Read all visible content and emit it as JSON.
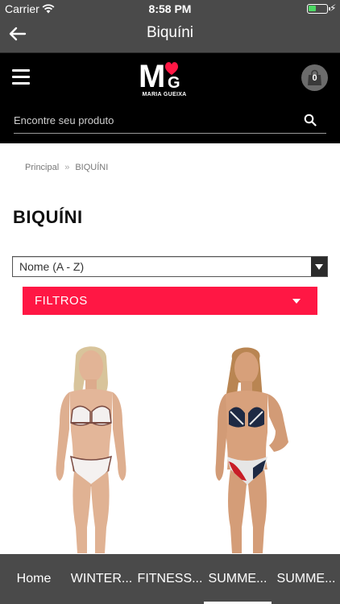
{
  "status_bar": {
    "carrier": "Carrier",
    "time": "8:58 PM"
  },
  "nav": {
    "title": "Biquíni"
  },
  "header": {
    "logo_text": "MG",
    "logo_caption": "MARIA GUEIXA",
    "cart_count": "0"
  },
  "search": {
    "placeholder": "Encontre seu produto"
  },
  "breadcrumb": {
    "home": "Principal",
    "separator": "»",
    "current": "BIQUÍNI"
  },
  "page": {
    "title": "BIQUÍNI"
  },
  "sort": {
    "selected": "Nome (A - Z)"
  },
  "filters": {
    "label": "FILTROS"
  },
  "tabs": [
    {
      "label": "Home"
    },
    {
      "label": "WINTER..."
    },
    {
      "label": "FITNESS..."
    },
    {
      "label": "SUMME..."
    },
    {
      "label": "SUMME..."
    }
  ],
  "colors": {
    "bar_gray": "#4a4a4a",
    "header_black": "#000000",
    "accent_red": "#ff1744",
    "battery_green": "#4cd964"
  },
  "icons": [
    "wifi-icon",
    "battery-icon",
    "back-arrow-icon",
    "menu-icon",
    "shopping-bag-icon",
    "search-icon",
    "chevron-down-icon"
  ]
}
